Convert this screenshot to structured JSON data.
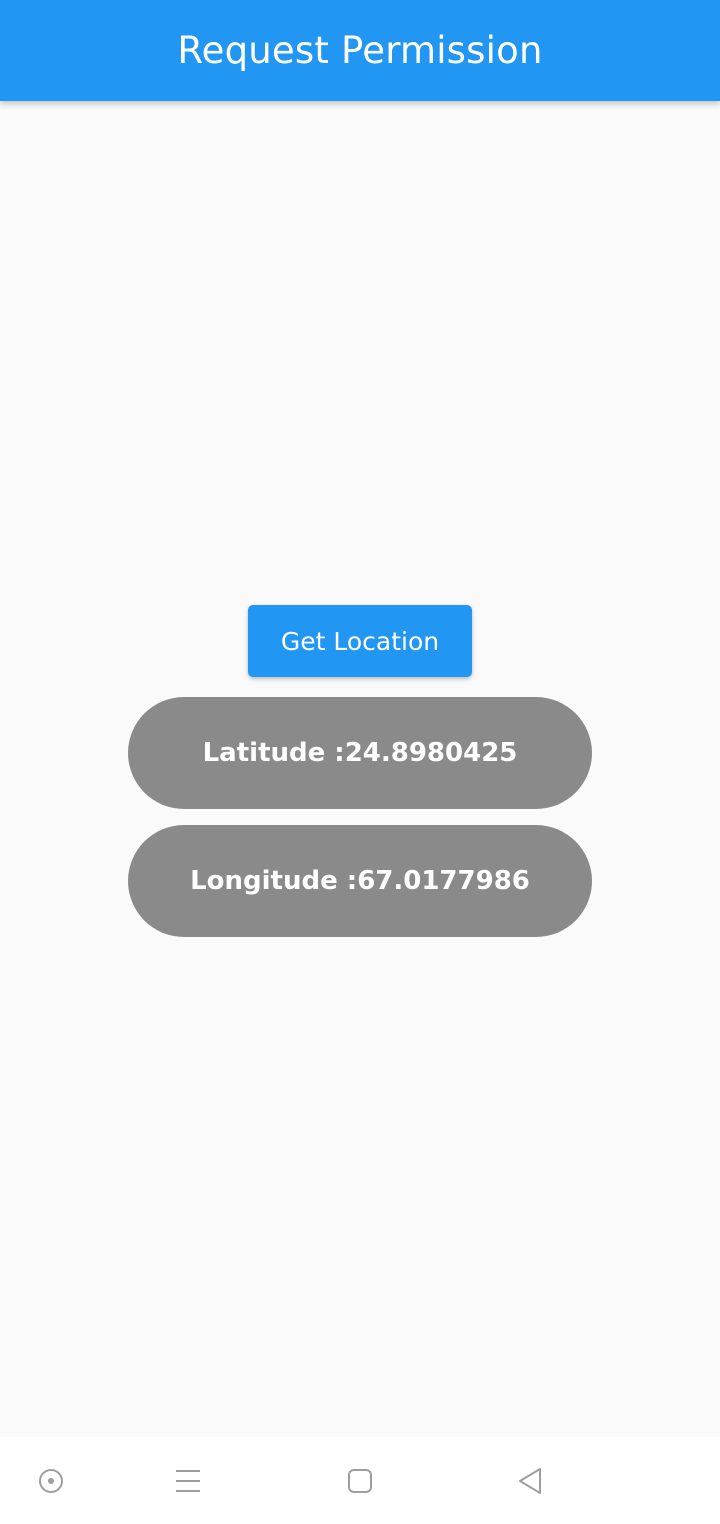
{
  "app_bar": {
    "title": "Request Permission",
    "color": "#2196f3"
  },
  "main": {
    "get_location_label": "Get Location",
    "latitude_text": "Latitude :24.8980425",
    "longitude_text": "Longitude :67.0177986",
    "pill_color": "#8a8a8a"
  },
  "nav_bar": {
    "icons": [
      "assistant-dot-icon",
      "menu-icon",
      "home-square-icon",
      "back-triangle-icon"
    ]
  }
}
